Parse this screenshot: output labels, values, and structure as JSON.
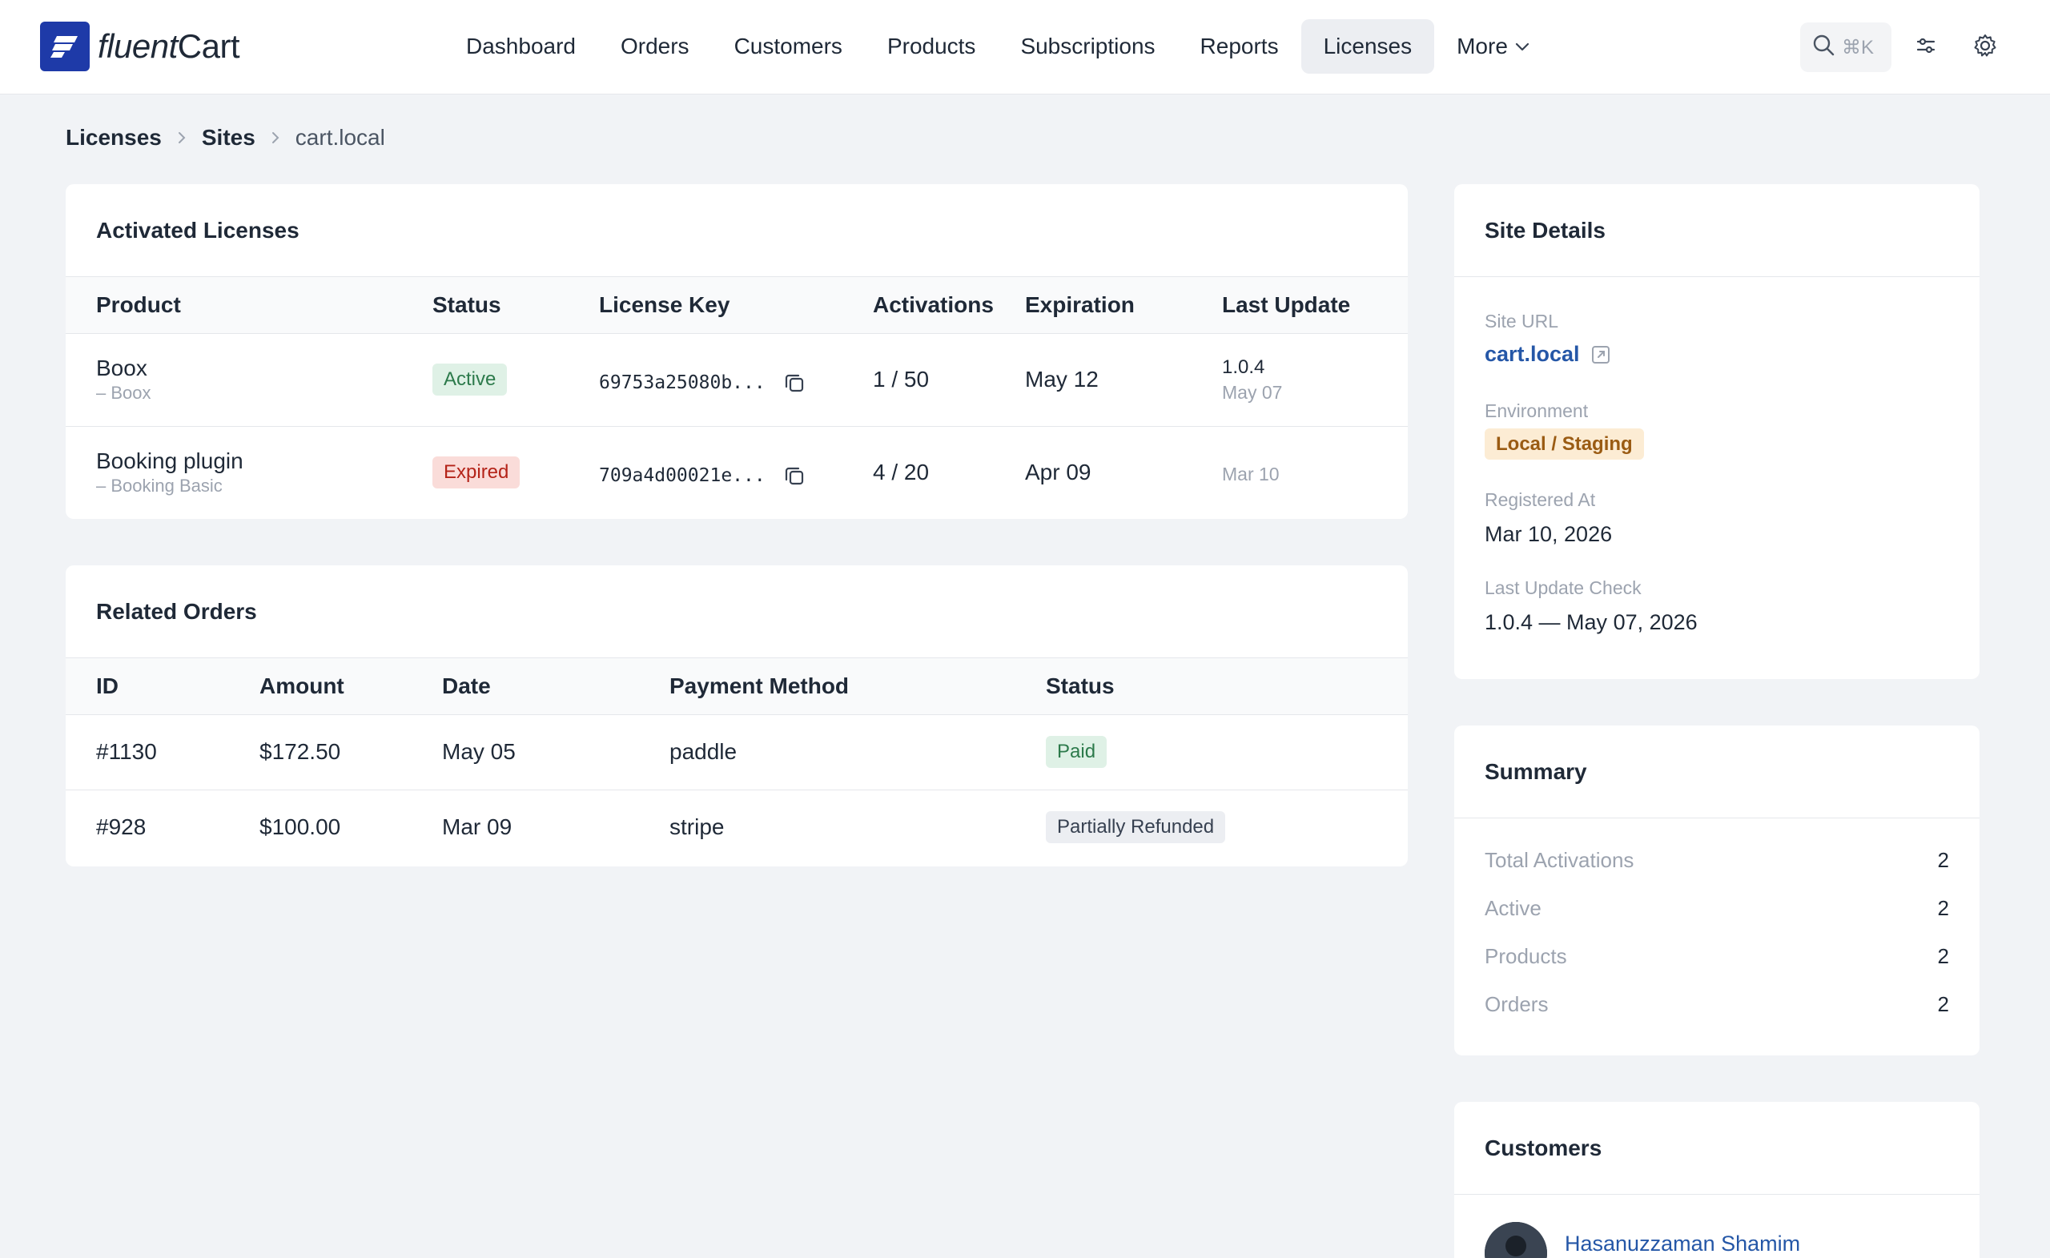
{
  "brand": {
    "name_part1": "fluent",
    "name_part2": "Cart",
    "accent": "#1e3aa8"
  },
  "nav": {
    "items": [
      {
        "label": "Dashboard"
      },
      {
        "label": "Orders"
      },
      {
        "label": "Customers"
      },
      {
        "label": "Products"
      },
      {
        "label": "Subscriptions"
      },
      {
        "label": "Reports"
      },
      {
        "label": "Licenses",
        "active": true
      },
      {
        "label": "More"
      }
    ],
    "search_shortcut": "⌘K"
  },
  "breadcrumb": [
    "Licenses",
    "Sites",
    "cart.local"
  ],
  "licenses": {
    "title": "Activated Licenses",
    "headers": [
      "Product",
      "Status",
      "License Key",
      "Activations",
      "Expiration",
      "Last Update"
    ],
    "rows": [
      {
        "product": "Boox",
        "variant": "– Boox",
        "status": "Active",
        "key": "69753a25080b...",
        "activations": "1 / 50",
        "expiration": "May 12",
        "version": "1.0.4",
        "updated": "May 07"
      },
      {
        "product": "Booking plugin",
        "variant": "– Booking Basic",
        "status": "Expired",
        "key": "709a4d00021e...",
        "activations": "4 / 20",
        "expiration": "Apr 09",
        "version": "",
        "updated": "Mar 10"
      }
    ]
  },
  "orders": {
    "title": "Related Orders",
    "headers": [
      "ID",
      "Amount",
      "Date",
      "Payment Method",
      "Status"
    ],
    "rows": [
      {
        "id": "#1130",
        "amount": "$172.50",
        "date": "May 05",
        "method": "paddle",
        "status": "Paid"
      },
      {
        "id": "#928",
        "amount": "$100.00",
        "date": "Mar 09",
        "method": "stripe",
        "status": "Partially Refunded"
      }
    ]
  },
  "site": {
    "title": "Site Details",
    "url_label": "Site URL",
    "url": "cart.local",
    "env_label": "Environment",
    "env": "Local / Staging",
    "registered_label": "Registered At",
    "registered": "Mar 10, 2026",
    "check_label": "Last Update Check",
    "check": "1.0.4 — May 07, 2026"
  },
  "summary": {
    "title": "Summary",
    "rows": [
      {
        "label": "Total Activations",
        "value": "2"
      },
      {
        "label": "Active",
        "value": "2"
      },
      {
        "label": "Products",
        "value": "2"
      },
      {
        "label": "Orders",
        "value": "2"
      }
    ]
  },
  "customers": {
    "title": "Customers",
    "list": [
      {
        "name": "Hasanuzzaman Shamim"
      }
    ]
  }
}
